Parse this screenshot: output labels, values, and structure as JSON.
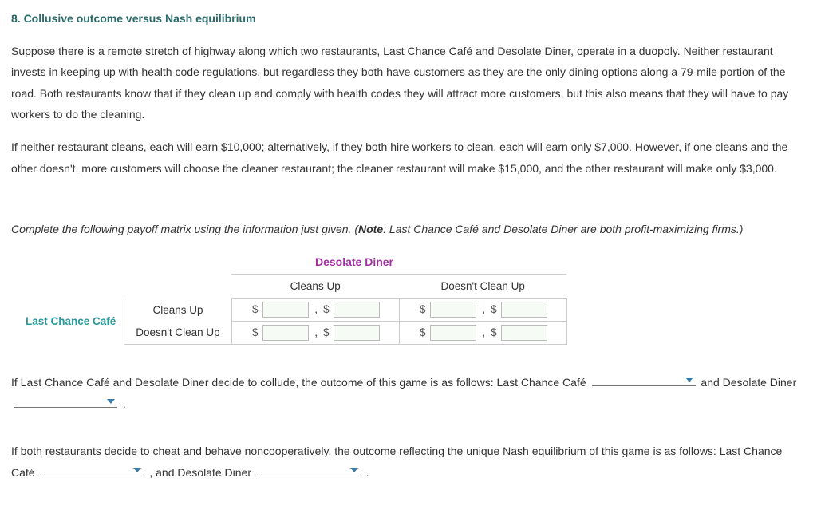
{
  "heading": "8. Collusive outcome versus Nash equilibrium",
  "para1": "Suppose there is a remote stretch of highway along which two restaurants, Last Chance Café and Desolate Diner, operate in a duopoly. Neither restaurant invests in keeping up with health code regulations, but regardless they both have customers as they are the only dining options along a 79-mile portion of the road. Both restaurants know that if they clean up and comply with health codes they will attract more customers, but this also means that they will have to pay workers to do the cleaning.",
  "para2": "If neither restaurant cleans, each will earn $10,000; alternatively, if they both hire workers to clean, each will earn only $7,000. However, if one cleans and the other doesn't, more customers will choose the cleaner restaurant; the cleaner restaurant will make $15,000, and the other restaurant will make only $3,000.",
  "instruction_pre": "Complete the following payoff matrix using the information just given. (",
  "instruction_bold": "Note",
  "instruction_post": ": Last Chance Café and Desolate Diner are both profit-maximizing firms.)",
  "matrix": {
    "col_player": "Desolate Diner",
    "row_player": "Last Chance Café",
    "col_strategies": [
      "Cleans Up",
      "Doesn't Clean Up"
    ],
    "row_strategies": [
      "Cleans Up",
      "Doesn't Clean Up"
    ],
    "cells": {
      "r0c0": {
        "a": "",
        "b": ""
      },
      "r0c1": {
        "a": "",
        "b": ""
      },
      "r1c0": {
        "a": "",
        "b": ""
      },
      "r1c1": {
        "a": "",
        "b": ""
      }
    }
  },
  "q1": {
    "t1": "If Last Chance Café and Desolate Diner decide to collude, the outcome of this game is as follows: Last Chance Café ",
    "t2": " and Desolate Diner ",
    "t3": " .",
    "sel1": "",
    "sel2": ""
  },
  "q2": {
    "t1": "If both restaurants decide to cheat and behave noncooperatively, the outcome reflecting the unique Nash equilibrium of this game is as follows: Last Chance Café ",
    "t2": " , and Desolate Diner ",
    "t3": " .",
    "sel1": "",
    "sel2": ""
  },
  "currency": "$"
}
